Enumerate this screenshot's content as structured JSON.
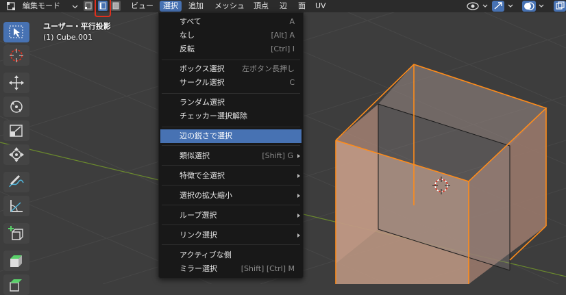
{
  "header": {
    "mode_label": "編集モード",
    "menus": [
      "ビュー",
      "選択",
      "追加",
      "メッシュ",
      "頂点",
      "辺",
      "面",
      "UV"
    ],
    "active_menu": "選択"
  },
  "overlay": {
    "view_name": "ユーザー・平行投影",
    "object_name": "(1) Cube.001"
  },
  "select_menu": {
    "items": [
      {
        "label": "すべて",
        "shortcut": "A"
      },
      {
        "label": "なし",
        "shortcut": "[Alt] A"
      },
      {
        "label": "反転",
        "shortcut": "[Ctrl] I"
      },
      {
        "label": "ボックス選択",
        "shortcut": "左ボタン長押し"
      },
      {
        "label": "サークル選択",
        "shortcut": "C"
      },
      {
        "label": "ランダム選択",
        "shortcut": ""
      },
      {
        "label": "チェッカー選択解除",
        "shortcut": ""
      },
      {
        "label": "辺の鋭さで選択",
        "shortcut": "",
        "highlighted": true
      },
      {
        "label": "類似選択",
        "shortcut": "[Shift] G",
        "submenu": true
      },
      {
        "label": "特徴で全選択",
        "shortcut": "",
        "submenu": true
      },
      {
        "label": "選択の拡大縮小",
        "shortcut": "",
        "submenu": true
      },
      {
        "label": "ループ選択",
        "shortcut": "",
        "submenu": true
      },
      {
        "label": "リンク選択",
        "shortcut": "",
        "submenu": true
      },
      {
        "label": "アクティブな側",
        "shortcut": ""
      },
      {
        "label": "ミラー選択",
        "shortcut": "[Shift] [Ctrl] M"
      }
    ]
  },
  "toolbar": {
    "tools": [
      "select-box-icon",
      "cursor-icon",
      "move-icon",
      "rotate-icon",
      "scale-icon",
      "transform-icon",
      "annotate-icon",
      "measure-icon",
      "add-cube-icon",
      "extrude-icon",
      "inset-icon"
    ],
    "active_tool": "select-box-icon"
  },
  "colors": {
    "header_bg": "#2b2b2b",
    "viewport_bg": "#3d3d3d",
    "menu_bg": "#181818",
    "highlight": "#4772b3",
    "selection_orange": "#ff8c1a",
    "red_annotation": "#e0301e"
  }
}
